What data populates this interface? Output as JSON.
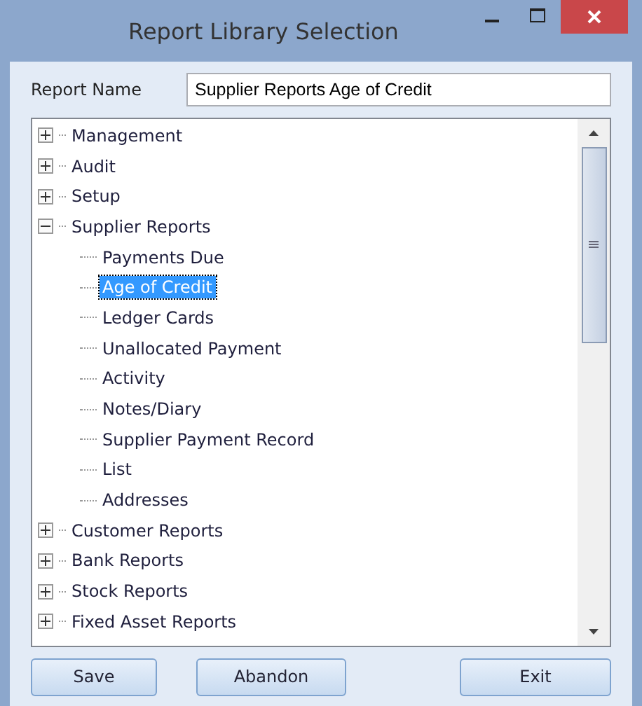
{
  "window": {
    "title": "Report Library Selection"
  },
  "report_name": {
    "label": "Report Name",
    "value": "Supplier Reports Age of Credit"
  },
  "tree": [
    {
      "label": "Management",
      "expanded": false,
      "selected": false
    },
    {
      "label": "Audit",
      "expanded": false,
      "selected": false
    },
    {
      "label": "Setup",
      "expanded": false,
      "selected": false
    },
    {
      "label": "Supplier Reports",
      "expanded": true,
      "selected": false,
      "children": [
        {
          "label": "Payments Due",
          "selected": false
        },
        {
          "label": "Age of Credit",
          "selected": true
        },
        {
          "label": "Ledger Cards",
          "selected": false
        },
        {
          "label": "Unallocated Payment",
          "selected": false
        },
        {
          "label": "Activity",
          "selected": false
        },
        {
          "label": "Notes/Diary",
          "selected": false
        },
        {
          "label": "Supplier Payment Record",
          "selected": false
        },
        {
          "label": "List",
          "selected": false
        },
        {
          "label": "Addresses",
          "selected": false
        }
      ]
    },
    {
      "label": "Customer Reports",
      "expanded": false,
      "selected": false
    },
    {
      "label": "Bank Reports",
      "expanded": false,
      "selected": false
    },
    {
      "label": "Stock Reports",
      "expanded": false,
      "selected": false
    },
    {
      "label": "Fixed Asset Reports",
      "expanded": false,
      "selected": false
    }
  ],
  "buttons": [
    {
      "label": "Save",
      "kind": "left"
    },
    {
      "label": "Abandon",
      "kind": "left"
    },
    {
      "label": "Exit",
      "kind": "right"
    }
  ]
}
